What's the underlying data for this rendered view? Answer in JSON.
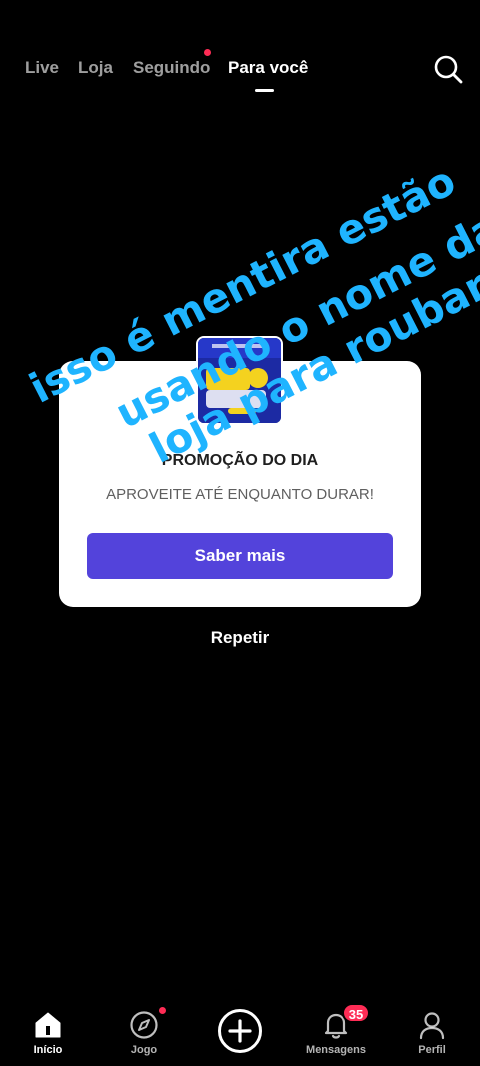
{
  "top_nav": {
    "tabs": [
      {
        "label": "Live",
        "active": false
      },
      {
        "label": "Loja",
        "active": false
      },
      {
        "label": "Seguindo",
        "active": false,
        "has_dot": true
      },
      {
        "label": "Para você",
        "active": true
      }
    ],
    "search_icon": "search-icon"
  },
  "ad": {
    "title": "PROMOÇÃO DO DIA",
    "subtitle": "APROVEITE ATÉ ENQUANTO DURAR!",
    "button_label": "Saber mais"
  },
  "repeat_label": "Repetir",
  "overlay_text": {
    "line1": "isso é mentira estão",
    "line2": "usando o nome da",
    "line3": "loja para roubar"
  },
  "bottom_nav": {
    "items": [
      {
        "label": "Início",
        "icon": "home-icon",
        "active": true
      },
      {
        "label": "Jogo",
        "icon": "compass-icon",
        "active": false,
        "has_dot": true
      },
      {
        "label": "",
        "icon": "plus-icon",
        "active": false
      },
      {
        "label": "Mensagens",
        "icon": "bell-icon",
        "active": false,
        "badge": "35"
      },
      {
        "label": "Perfil",
        "icon": "person-icon",
        "active": false
      }
    ]
  },
  "colors": {
    "accent_button": "#5343db",
    "notification": "#fe2c55",
    "overlay_text": "#1fb4ff"
  }
}
